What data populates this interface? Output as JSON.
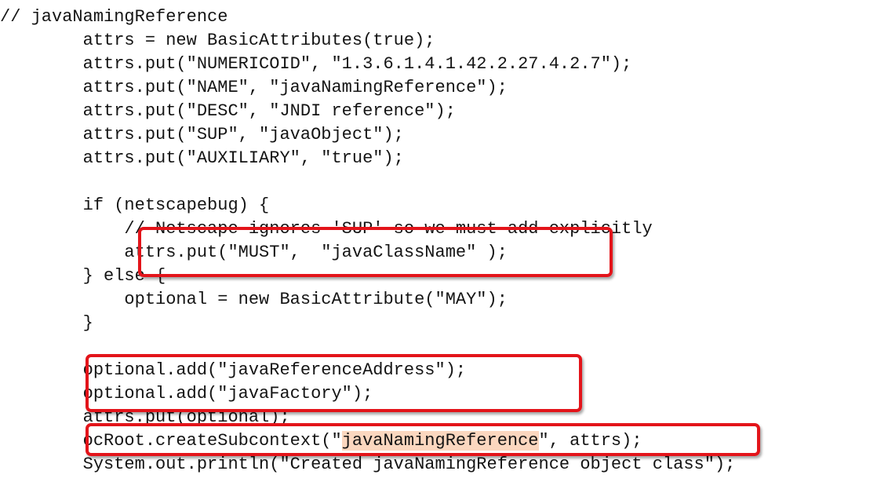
{
  "code": {
    "lines": [
      {
        "indent": 0,
        "text": "// javaNamingReference"
      },
      {
        "indent": 8,
        "text": "attrs = new BasicAttributes(true);"
      },
      {
        "indent": 8,
        "text": "attrs.put(\"NUMERICOID\", \"1.3.6.1.4.1.42.2.27.4.2.7\");"
      },
      {
        "indent": 8,
        "text": "attrs.put(\"NAME\", \"javaNamingReference\");"
      },
      {
        "indent": 8,
        "text": "attrs.put(\"DESC\", \"JNDI reference\");"
      },
      {
        "indent": 8,
        "text": "attrs.put(\"SUP\", \"javaObject\");"
      },
      {
        "indent": 8,
        "text": "attrs.put(\"AUXILIARY\", \"true\");"
      },
      {
        "indent": 0,
        "text": ""
      },
      {
        "indent": 8,
        "text": "if (netscapebug) {"
      },
      {
        "indent": 12,
        "text": "// Netscape ignores 'SUP' so we must add explicitly"
      },
      {
        "indent": 12,
        "text": "attrs.put(\"MUST\",  \"javaClassName\" );"
      },
      {
        "indent": 8,
        "text": "} else {"
      },
      {
        "indent": 12,
        "text": "optional = new BasicAttribute(\"MAY\");"
      },
      {
        "indent": 8,
        "text": "}"
      },
      {
        "indent": 0,
        "text": ""
      },
      {
        "indent": 8,
        "text": "optional.add(\"javaReferenceAddress\");"
      },
      {
        "indent": 8,
        "text": "optional.add(\"javaFactory\");"
      },
      {
        "indent": 8,
        "text": "attrs.put(optional);"
      },
      {
        "indent": 8,
        "text": "ocRoot.createSubcontext(\"javaNamingReference\", attrs);",
        "highlight": "javaNamingReference"
      },
      {
        "indent": 8,
        "text": "System.out.println(\"Created javaNamingReference object class\");"
      }
    ]
  },
  "colors": {
    "text": "#141414",
    "annotation_box": "#e3141a",
    "highlight": "#fbd7bf"
  }
}
